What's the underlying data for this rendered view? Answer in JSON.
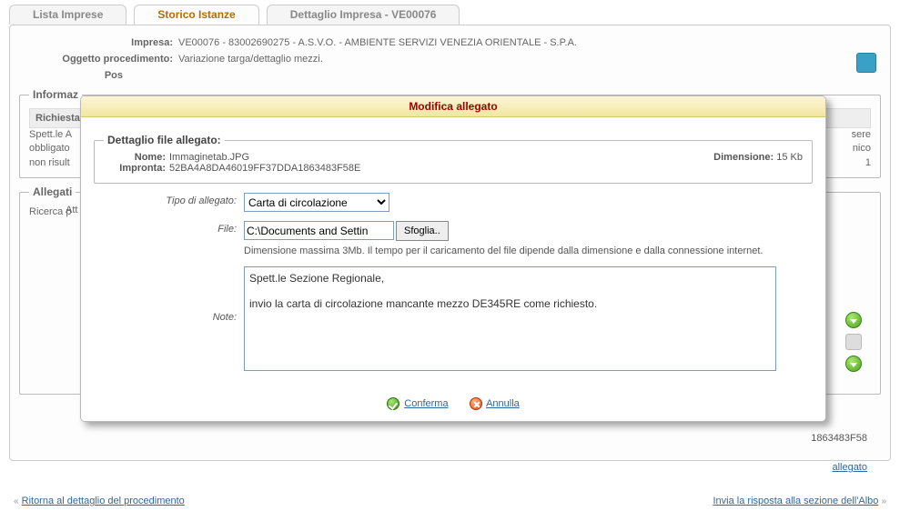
{
  "tabs": {
    "t0": "Lista Imprese",
    "t1": "Storico Istanze",
    "t2": "Dettaglio Impresa - VE00076"
  },
  "header": {
    "impresa_label": "Impresa:",
    "impresa_value": "VE00076 - 83002690275 - A.S.V.O. - AMBIENTE SERVIZI VENEZIA ORIENTALE - S.P.A.",
    "oggetto_label": "Oggetto procedimento:",
    "oggetto_value": "Variazione targa/dettaglio mezzi.",
    "pos_label": "Pos"
  },
  "bg": {
    "informaz_legend": "Informaz",
    "richiesta_band": "Richiesta",
    "richiesta_text1": "Spett.le A",
    "richiesta_text2": "obbligato",
    "richiesta_text3": "non risult",
    "richiesta_right1": "sere",
    "richiesta_right2": "nico",
    "richiesta_right3": "1",
    "allegati_legend": "Allegati",
    "ricerca_label": "Ricerca p",
    "atti_label": "Att",
    "impronta_tail": "1863483F58",
    "allegato_link": "allegato"
  },
  "footer_links": {
    "back": "Ritorna al dettaglio del procedimento",
    "send": "Invia la risposta alla sezione dell'Albo"
  },
  "modal": {
    "title": "Modifica allegato",
    "fs_legend": "Dettaglio file allegato:",
    "nome_label": "Nome:",
    "nome_value": "Immaginetab.JPG",
    "dim_label": "Dimensione:",
    "dim_value": "15 Kb",
    "impronta_label": "Impronta:",
    "impronta_value": "52BA4A8DA46019FF37DDA1863483F58E",
    "tipo_label": "Tipo di allegato:",
    "tipo_value": "Carta di circolazione",
    "file_label": "File:",
    "file_value": "C:\\Documents and Settin",
    "browse_label": "Sfoglia..",
    "file_hint": "Dimensione massima 3Mb. Il tempo per il caricamento del file dipende dalla dimensione e dalla connessione internet.",
    "note_label": "Note:",
    "note_value": "Spett.le Sezione Regionale,\n\ninvio la carta di circolazione mancante mezzo DE345RE come richiesto.",
    "confirm": "Conferma",
    "cancel": "Annulla"
  }
}
